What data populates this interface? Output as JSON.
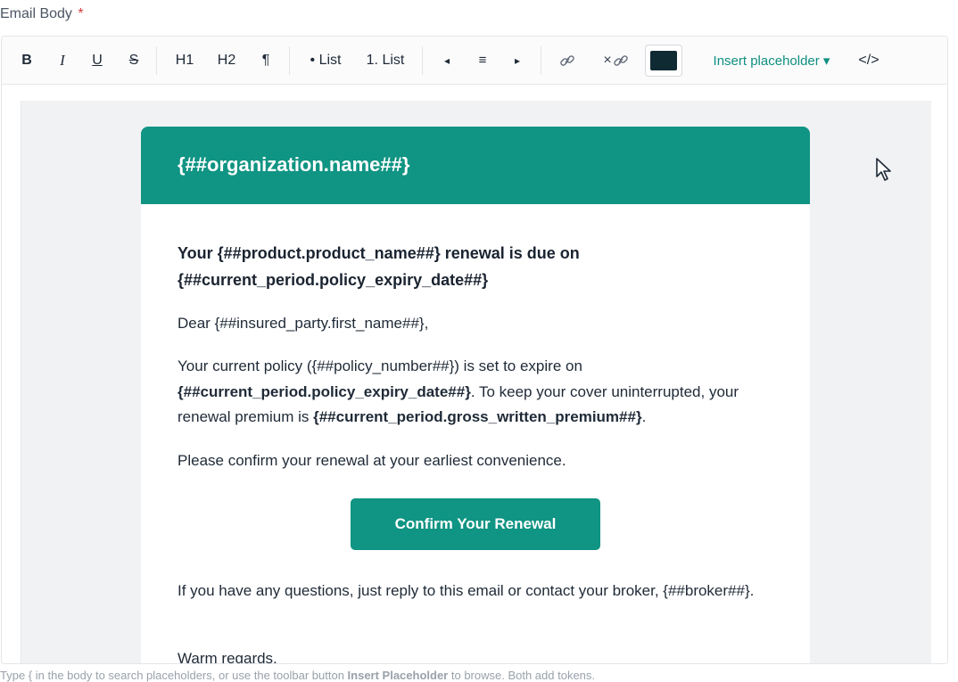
{
  "field": {
    "label": "Email Body",
    "required_mark": "*"
  },
  "toolbar": {
    "bold": "B",
    "italic": "I",
    "underline": "U",
    "strike": "S",
    "h1": "H1",
    "h2": "H2",
    "paragraph": "¶",
    "bullet_list": "• List",
    "numbered_list": "1. List",
    "align_left": "◂",
    "align_center": "≡",
    "align_right": "▸",
    "link_icon": "link-icon",
    "unlink_icon": "unlink-icon",
    "unlink_prefix": "×",
    "text_color": "#0f2a33",
    "insert_placeholder": "Insert placeholder ▾",
    "source": "</>"
  },
  "email": {
    "header": "{##organization.name##}",
    "headline": "Your {##product.product_name##} renewal is due on {##current_period.policy_expiry_date##}",
    "greeting": "Dear {##insured_party.first_name##},",
    "p1_a": "Your current policy ({##policy_number##}) is set to expire on ",
    "p1_b": "{##current_period.policy_expiry_date##}",
    "p1_c": ". To keep your cover uninterrupted, your renewal premium is ",
    "p1_d": "{##current_period.gross_written_premium##}",
    "p1_e": ".",
    "p2": "Please confirm your renewal at your earliest convenience.",
    "cta": "Confirm Your Renewal",
    "p3": "If you have any questions, just reply to this email or contact your broker, {##broker##}.",
    "signoff": "Warm regards,"
  },
  "helper": {
    "a": "Type { in the body to search placeholders, or use the toolbar button ",
    "b": "Insert Placeholder",
    "c": " to browse. Both add tokens."
  },
  "colors": {
    "brand": "#109483",
    "canvas": "#f1f2f4"
  }
}
